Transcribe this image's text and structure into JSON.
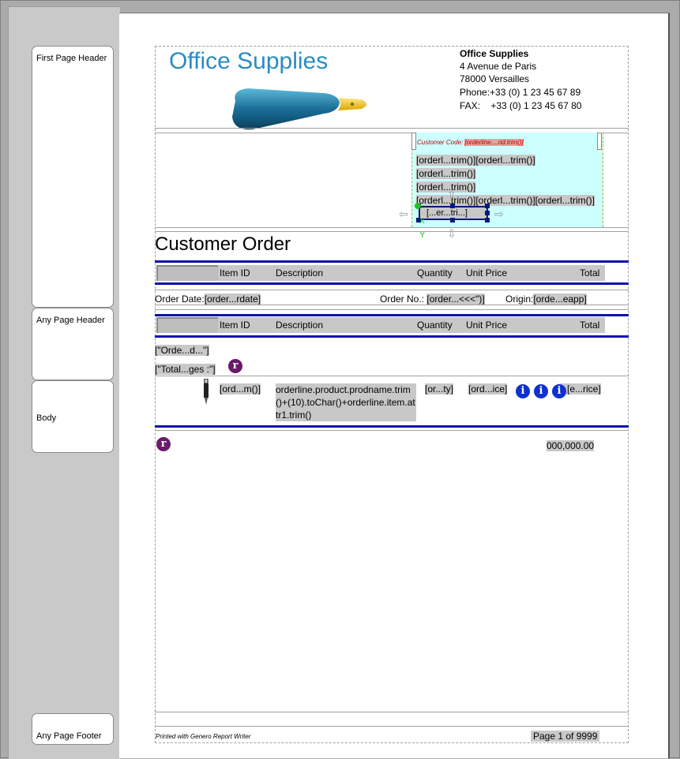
{
  "sections": {
    "first_page_header": "First Page Header",
    "any_page_header": "Any Page Header",
    "body": "Body",
    "any_page_footer": "Any Page Footer"
  },
  "company": {
    "logo_word1": "Office",
    "logo_word2": "Supplies",
    "name": "Office Supplies",
    "address1": "4 Avenue de Paris",
    "address2": "78000 Versailles",
    "phone": "Phone:+33 (0) 1 23 45 67 89",
    "fax_label": "FAX:",
    "fax_value": "+33 (0) 1 23 45 67 80"
  },
  "customer_box": {
    "code_label": "Customer Code:",
    "code_value": "[orderline....rid.trim()]",
    "lines": [
      "[orderl...trim()][orderl...trim()]",
      "[orderl...trim()]",
      "[orderl...trim()]",
      "[orderl...trim()][orderl...trim()][orderl...trim()]"
    ],
    "selected_field": "[...er...tri...]",
    "axis_x": "X",
    "axis_y": "Y"
  },
  "title": "Customer Order",
  "columns": {
    "item_id": "Item ID",
    "description": "Description",
    "quantity": "Quantity",
    "unit_price": "Unit Price",
    "total": "Total"
  },
  "order_info": {
    "date_label": "Order Date:",
    "date_value": "[order...rdate]",
    "number_label": "Order No.:",
    "number_value": "[order...<<<\")]",
    "origin_label": "Origin:",
    "origin_value": "[orde...eapp]"
  },
  "group": {
    "order_field": "[\"Orde...d...\"]",
    "total_pages_field": "[\"Total...ges :\"]"
  },
  "body_row": {
    "item_id": "[ord...m()]",
    "description": "orderline.product.prodname.trim()+(10).toChar()+orderline.item.attr1.trim()",
    "quantity": "[or...ty]",
    "unit_price": "[ord...ice]",
    "total": "[e...rice]"
  },
  "sum_total": "000,000.00",
  "footer": {
    "printed_with": "Printed with Genero Report Writer",
    "page_of": "Page 1 of 9999"
  },
  "icons": {
    "rtl": "r",
    "info": "i"
  },
  "colors": {
    "accent_blue": "#1010b0",
    "logo_blue": "#2b8cc4",
    "selection_fill": "#ccffff",
    "field_gray": "#c8c8c8"
  }
}
